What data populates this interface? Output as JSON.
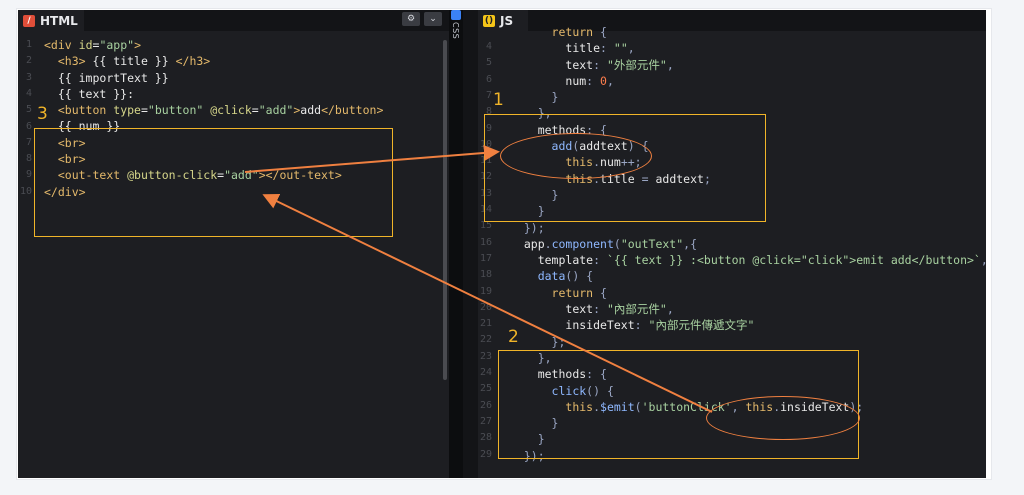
{
  "html_tab": {
    "label": "HTML",
    "icon": "html-icon",
    "color": "#e04e39"
  },
  "js_tab": {
    "label": "JS",
    "icon": "js-icon",
    "color": "#f5c518"
  },
  "css_tab": {
    "label": "CSS"
  },
  "html_buttons": {
    "settings": "⚙",
    "collapse": "⌄"
  },
  "html_line_numbers": [
    "1",
    "2",
    "3",
    "4",
    "5",
    "6",
    "7",
    "8",
    "9",
    "10"
  ],
  "js_line_numbers": [
    "4",
    "5",
    "6",
    "7",
    "8",
    "9",
    "10",
    "11",
    "12",
    "13",
    "14",
    "15",
    "16",
    "17",
    "18",
    "19",
    "20",
    "21",
    "22",
    "23",
    "24",
    "25",
    "26",
    "27",
    "28",
    "29"
  ],
  "annotations": {
    "n1": "1",
    "n2": "2",
    "n3": "3"
  },
  "accent_colors": {
    "box": "#f0b429",
    "arrow": "#f08040"
  }
}
